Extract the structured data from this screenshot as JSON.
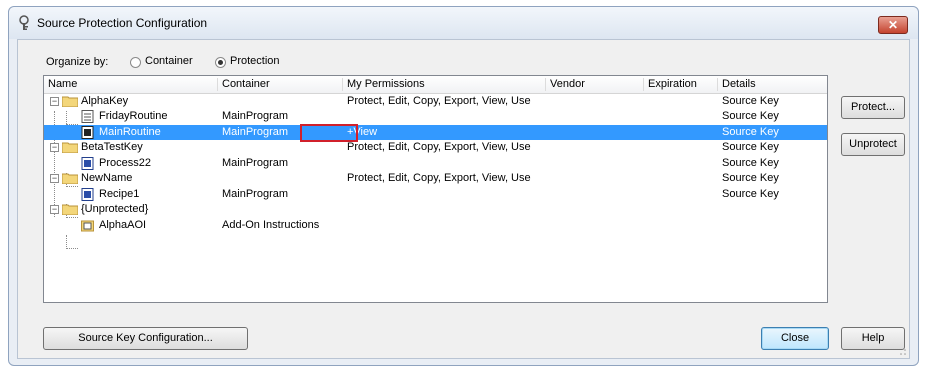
{
  "window": {
    "title": "Source Protection Configuration"
  },
  "organize": {
    "label": "Organize by:",
    "options": [
      {
        "label": "Container",
        "selected": false
      },
      {
        "label": "Protection",
        "selected": true
      }
    ]
  },
  "columns": [
    "Name",
    "Container",
    "My Permissions",
    "Vendor",
    "Expiration",
    "Details"
  ],
  "rows": [
    {
      "name": "AlphaKey",
      "container": "",
      "permissions": "Protect, Edit, Copy, Export, View, Use",
      "details": "Source Key",
      "kind": "folder",
      "selected": false
    },
    {
      "name": "FridayRoutine",
      "container": "MainProgram",
      "permissions": "",
      "details": "Source Key",
      "kind": "routine",
      "selected": false
    },
    {
      "name": "MainRoutine",
      "container": "MainProgram",
      "permissions": "+View",
      "details": "Source Key",
      "kind": "routine",
      "selected": true
    },
    {
      "name": "BetaTestKey",
      "container": "",
      "permissions": "Protect, Edit, Copy, Export, View, Use",
      "details": "Source Key",
      "kind": "folder",
      "selected": false
    },
    {
      "name": "Process22",
      "container": "MainProgram",
      "permissions": "",
      "details": "Source Key",
      "kind": "routine",
      "selected": false
    },
    {
      "name": "NewName",
      "container": "",
      "permissions": "Protect, Edit, Copy, Export, View, Use",
      "details": "Source Key",
      "kind": "folder",
      "selected": false
    },
    {
      "name": "Recipe1",
      "container": "MainProgram",
      "permissions": "",
      "details": "Source Key",
      "kind": "routine",
      "selected": false
    },
    {
      "name": "{Unprotected}",
      "container": "",
      "permissions": "",
      "details": "",
      "kind": "folder",
      "selected": false
    },
    {
      "name": "AlphaAOI",
      "container": "Add-On Instructions",
      "permissions": "",
      "details": "",
      "kind": "aoi",
      "selected": false
    }
  ],
  "buttons": {
    "protect": "Protect...",
    "unprotect": "Unprotect",
    "source_key_config": "Source Key Configuration...",
    "close": "Close",
    "help": "Help"
  },
  "colors": {
    "selection": "#3399ff",
    "highlight_box": "#d1202b",
    "close_button": "#c4432f"
  }
}
